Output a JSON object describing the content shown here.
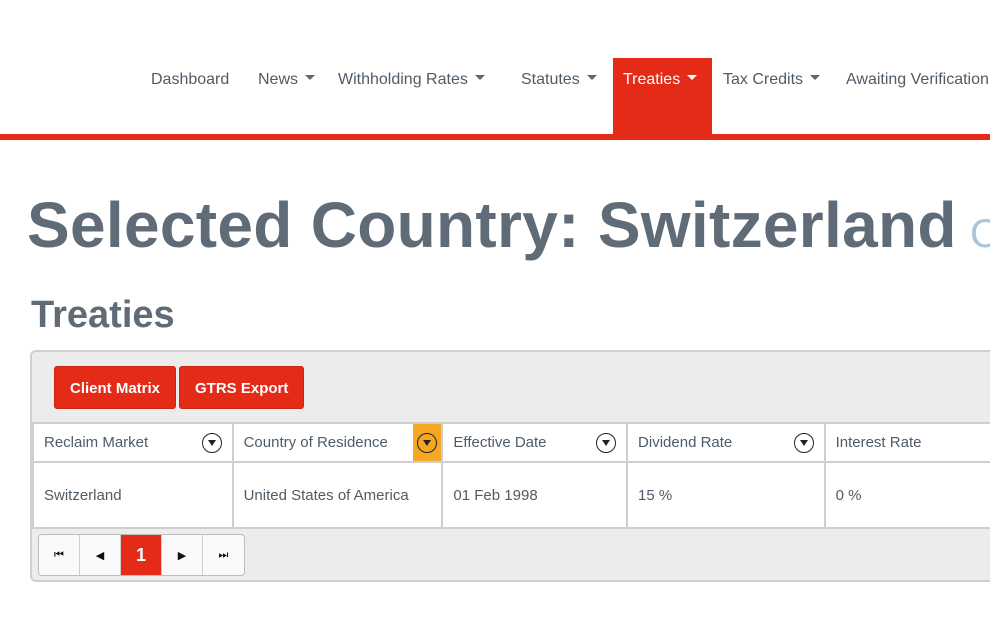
{
  "nav": {
    "items": [
      {
        "label": "Dashboard",
        "has_dropdown": false,
        "active": false
      },
      {
        "label": "News",
        "has_dropdown": true,
        "active": false
      },
      {
        "label": "Withholding Rates",
        "has_dropdown": true,
        "active": false
      },
      {
        "label": "Statutes",
        "has_dropdown": true,
        "active": false
      },
      {
        "label": "Treaties",
        "has_dropdown": true,
        "active": true
      },
      {
        "label": "Tax Credits",
        "has_dropdown": true,
        "active": false
      },
      {
        "label": "Awaiting Verification",
        "has_dropdown": false,
        "active": false
      }
    ],
    "accent_color": "#e32b17"
  },
  "header": {
    "prefix": "Selected Country: ",
    "country": "Switzerland",
    "partial_glyph": "C"
  },
  "section": {
    "title": "Treaties"
  },
  "toolbar": {
    "client_matrix_label": "Client Matrix",
    "gtrs_export_label": "GTRS Export"
  },
  "grid": {
    "columns": [
      {
        "label": "Reclaim Market",
        "filter": true,
        "filter_active": false
      },
      {
        "label": "Country of Residence",
        "filter": true,
        "filter_active": true
      },
      {
        "label": "Effective Date",
        "filter": true,
        "filter_active": false
      },
      {
        "label": "Dividend Rate",
        "filter": true,
        "filter_active": false
      },
      {
        "label": "Interest Rate",
        "filter": false,
        "filter_active": false
      }
    ],
    "rows": [
      [
        "Switzerland",
        "United States of America",
        "01 Feb 1998",
        "15 %",
        "0 %"
      ]
    ],
    "active_filter_color": "#f5a623"
  },
  "pager": {
    "first_icon": "first-page-icon",
    "prev_icon": "prev-page-icon",
    "current_page": "1",
    "next_icon": "next-page-icon",
    "last_icon": "last-page-icon"
  }
}
